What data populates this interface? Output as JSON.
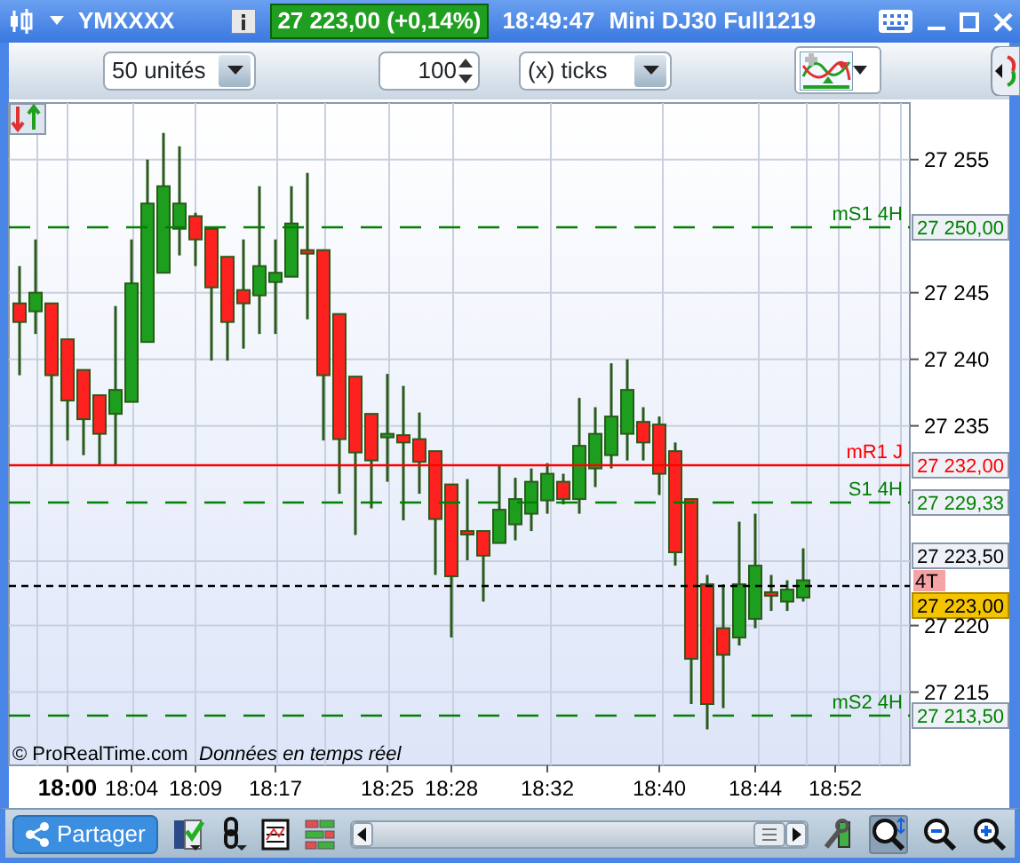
{
  "title_bar": {
    "symbol": "YMXXXX",
    "price_badge": "27 223,00 (+0,14%)",
    "time": "18:49:47",
    "instrument": "Mini DJ30 Full1219"
  },
  "toolbar": {
    "period": "50 unités",
    "tick_count": "100",
    "tick_unit": "(x) ticks"
  },
  "chart": {
    "chart_data": {
      "type": "candlestick",
      "categories": [
        null,
        null,
        null,
        "18:00",
        null,
        null,
        null,
        "18:04",
        null,
        null,
        null,
        "18:09",
        null,
        null,
        null,
        null,
        "18:17",
        null,
        null,
        null,
        null,
        null,
        null,
        "18:25",
        null,
        null,
        null,
        "18:28",
        null,
        null,
        null,
        null,
        null,
        "18:32",
        null,
        null,
        null,
        null,
        null,
        null,
        "18:40",
        null,
        null,
        null,
        null,
        null,
        "18:44",
        null,
        null,
        null,
        null,
        "18:52"
      ],
      "ohlc": [
        [
          27244.2,
          27247,
          27238.8,
          27242.8
        ],
        [
          27243.6,
          27249,
          27241.9,
          27245
        ],
        [
          27244.2,
          27244.2,
          27232,
          27238.8
        ],
        [
          27241.5,
          27241.5,
          27233.9,
          27236.9
        ],
        [
          27239.2,
          27239.2,
          27232.8,
          27235.5
        ],
        [
          27237.3,
          27237.3,
          27232,
          27234.4
        ],
        [
          27235.9,
          27244,
          27232,
          27237.7
        ],
        [
          27236.8,
          27249,
          27236.8,
          27245.7
        ],
        [
          27241.3,
          27255,
          27241.3,
          27251.7
        ],
        [
          27246.5,
          27257,
          27246.5,
          27253
        ],
        [
          27249.8,
          27256,
          27247.8,
          27251.7
        ],
        [
          27250.75,
          27251,
          27247,
          27249
        ],
        [
          27249.8,
          27249.8,
          27239.9,
          27245.4
        ],
        [
          27247.7,
          27247.7,
          27239.9,
          27242.8
        ],
        [
          27245.2,
          27249,
          27240.8,
          27244.2
        ],
        [
          27244.8,
          27253,
          27241.9,
          27247
        ],
        [
          27245.8,
          27249,
          27241.9,
          27246.5
        ],
        [
          27246.2,
          27253,
          27246.2,
          27250.2
        ],
        [
          27248.2,
          27254,
          27243,
          27248.1
        ],
        [
          27248.2,
          27248.2,
          27233.9,
          27238.8
        ],
        [
          27243.4,
          27243.4,
          27229.9,
          27234
        ],
        [
          27238.7,
          27238.7,
          27226.8,
          27233
        ],
        [
          27235.9,
          27235.9,
          27228.8,
          27232.4
        ],
        [
          27234.2,
          27238.9,
          27230.8,
          27234.4
        ],
        [
          27234.3,
          27238,
          27227.9,
          27233.75
        ],
        [
          27234,
          27236,
          27229.9,
          27232.3
        ],
        [
          27233.1,
          27233.1,
          27223.8,
          27228
        ],
        [
          27230.6,
          27230.6,
          27219.1,
          27223.7
        ],
        [
          27227.1,
          27231,
          27224.9,
          27227
        ],
        [
          27227.1,
          27227.1,
          27221.8,
          27225.25
        ],
        [
          27226.2,
          27232,
          27226.2,
          27228.7
        ],
        [
          27227.6,
          27231.1,
          27226.4,
          27229.5
        ],
        [
          27228.4,
          27231.8,
          27227.1,
          27230.8
        ],
        [
          27229.4,
          27232.2,
          27228.4,
          27231.4
        ],
        [
          27230.8,
          27231.4,
          27229.1,
          27229.5
        ],
        [
          27229.5,
          27237.1,
          27228.4,
          27233.5
        ],
        [
          27231.8,
          27236.4,
          27230.4,
          27234.4
        ],
        [
          27232.8,
          27239.7,
          27231.8,
          27235.7
        ],
        [
          27234.4,
          27240,
          27232.4,
          27237.7
        ],
        [
          27235.3,
          27236.4,
          27232.4,
          27233.75
        ],
        [
          27235.1,
          27235.7,
          27229.8,
          27231.4
        ],
        [
          27233.1,
          27233.75,
          27224.5,
          27225.5
        ],
        [
          27229.5,
          27229.5,
          27214.1,
          27217.5
        ],
        [
          27223.1,
          27223.8,
          27212.2,
          27214.1
        ],
        [
          27219.8,
          27223.1,
          27213.8,
          27217.8
        ],
        [
          27219.1,
          27227.8,
          27218.5,
          27223.1
        ],
        [
          27220.5,
          27228.4,
          27219.8,
          27224.5
        ],
        [
          27222.5,
          27223.8,
          27221.1,
          27222.3
        ],
        [
          27221.8,
          27223.4,
          27221.1,
          27222.7
        ],
        [
          27222.1,
          27225.8,
          27221.8,
          27223.4
        ],
        null,
        null
      ],
      "ylim": [
        27209.5,
        27259.25
      ],
      "grid": true,
      "yticks": [
        {
          "value": 27255,
          "label": "27 255"
        },
        {
          "value": 27245,
          "label": "27 245"
        },
        {
          "value": 27240,
          "label": "27 240"
        },
        {
          "value": 27235,
          "label": "27 235"
        },
        {
          "value": 27220,
          "label": "27 220"
        },
        {
          "value": 27215,
          "label": "27 215"
        }
      ]
    },
    "levels": [
      {
        "label": "mS1 4H",
        "value": "27 250,00",
        "color": "#008000"
      },
      {
        "label": "mR1 J",
        "value": "27 232,00",
        "color": "#ff0000"
      },
      {
        "label": "S1 4H",
        "value": "27 229,33",
        "color": "#008000"
      },
      {
        "label": "mS2 4H",
        "value": "27 213,50",
        "color": "#008000"
      }
    ],
    "marker_value": "27 223,50",
    "last_price": "27 223,00",
    "tick_badge": "4T",
    "copyright": "© ProRealTime.com",
    "data_note": "Données en temps réel"
  },
  "bottom_toolbar": {
    "share_label": "Partager",
    "autoscale_selected": true
  }
}
